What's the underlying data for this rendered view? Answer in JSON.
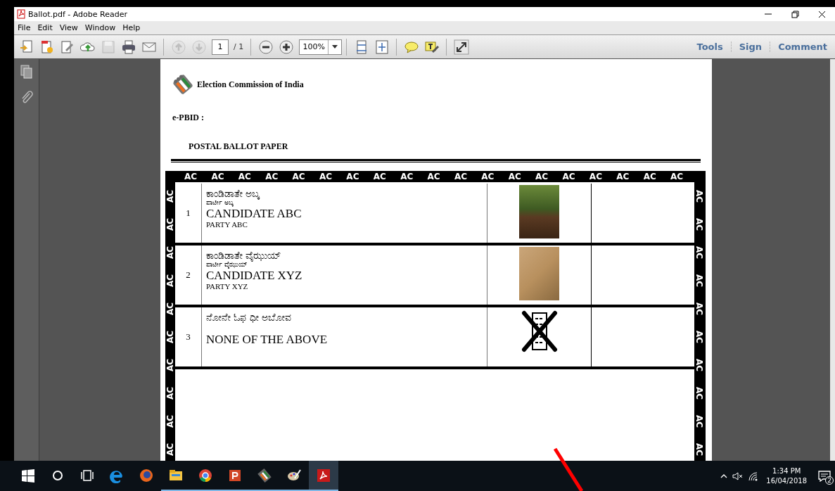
{
  "window": {
    "title": "Ballot.pdf - Adobe Reader"
  },
  "menu": [
    "File",
    "Edit",
    "View",
    "Window",
    "Help"
  ],
  "toolbar": {
    "file_buttons": [
      {
        "kind": "create",
        "disabled": false
      },
      {
        "kind": "share",
        "disabled": false
      },
      {
        "kind": "edit",
        "disabled": false
      },
      {
        "kind": "upload",
        "disabled": false
      },
      {
        "kind": "save",
        "disabled": true
      },
      {
        "kind": "print",
        "disabled": false
      },
      {
        "kind": "mail",
        "disabled": false
      }
    ],
    "nav_buttons": [
      {
        "kind": "prev",
        "disabled": true
      },
      {
        "kind": "next",
        "disabled": true
      }
    ],
    "page_number": "1",
    "page_total": "/ 1",
    "zoom_buttons": [
      {
        "kind": "zoom-out",
        "disabled": false
      },
      {
        "kind": "zoom-in",
        "disabled": false
      }
    ],
    "zoom": "100%",
    "view_buttons": [
      {
        "kind": "fit-width",
        "disabled": false
      },
      {
        "kind": "fit-page",
        "disabled": false
      }
    ],
    "comment_buttons": [
      {
        "kind": "note",
        "disabled": false
      },
      {
        "kind": "highlight",
        "disabled": false
      }
    ],
    "mode_buttons": [
      {
        "kind": "expand",
        "disabled": false
      }
    ],
    "panels": [
      "Tools",
      "Sign",
      "Comment"
    ]
  },
  "document": {
    "header": "Election Commission of India",
    "epbid_label": "e-PBID :",
    "title": "POSTAL BALLOT PAPER",
    "top_marks": [
      "AC",
      "AC",
      "AC",
      "AC",
      "AC",
      "AC",
      "AC",
      "AC",
      "AC",
      "AC",
      "AC",
      "AC",
      "AC",
      "AC",
      "AC",
      "AC",
      "AC",
      "AC",
      "AC"
    ],
    "left_marks": [
      "AC",
      "AC",
      "AC",
      "AC",
      "AC",
      "AC",
      "AC",
      "AC",
      "AC",
      "AC"
    ],
    "right_marks": [
      "AC",
      "AC",
      "AC",
      "AC",
      "AC",
      "AC",
      "AC",
      "AC",
      "AC",
      "AC"
    ],
    "rows": [
      {
        "number": "1",
        "name_local": "ಕಾಂಡಿಡಾತೇ ಅಬ್ಕ",
        "party_local": "ಪಾರ್ಟೀ ಅಬ್ಕ",
        "name": "CANDIDATE ABC",
        "party": "PARTY ABC",
        "kind": "plant-photo"
      },
      {
        "number": "2",
        "name_local": "ಕಾಂಡಿಡಾತೇ ವೈಝುಯ್",
        "party_local": "ಪಾರ್ಟೀ ವೈಝುಯ್",
        "name": "CANDIDATE XYZ",
        "party": "PARTY XYZ",
        "kind": "cat-photo"
      },
      {
        "number": "3",
        "name_local": "ನೋನೇ ಓಫ ಧೀ ಅಬೋವ",
        "name": "NONE OF THE ABOVE",
        "kind": "nota"
      }
    ]
  },
  "taskbar": {
    "apps": [
      {
        "kind": "start",
        "running": false,
        "selected": false
      },
      {
        "kind": "search",
        "running": false,
        "selected": false
      },
      {
        "kind": "task-view",
        "running": false,
        "selected": false
      },
      {
        "kind": "edge",
        "running": false,
        "selected": false
      },
      {
        "kind": "firefox",
        "running": false,
        "selected": false
      },
      {
        "kind": "explorer",
        "running": true,
        "selected": false
      },
      {
        "kind": "chrome",
        "running": true,
        "selected": false
      },
      {
        "kind": "powerpoint",
        "running": true,
        "selected": false
      },
      {
        "kind": "voting",
        "running": true,
        "selected": false
      },
      {
        "kind": "paint",
        "running": true,
        "selected": false
      },
      {
        "kind": "acrobat",
        "running": true,
        "selected": true
      }
    ],
    "time": "1:34 PM",
    "date": "16/04/2018",
    "notifications": "2"
  }
}
